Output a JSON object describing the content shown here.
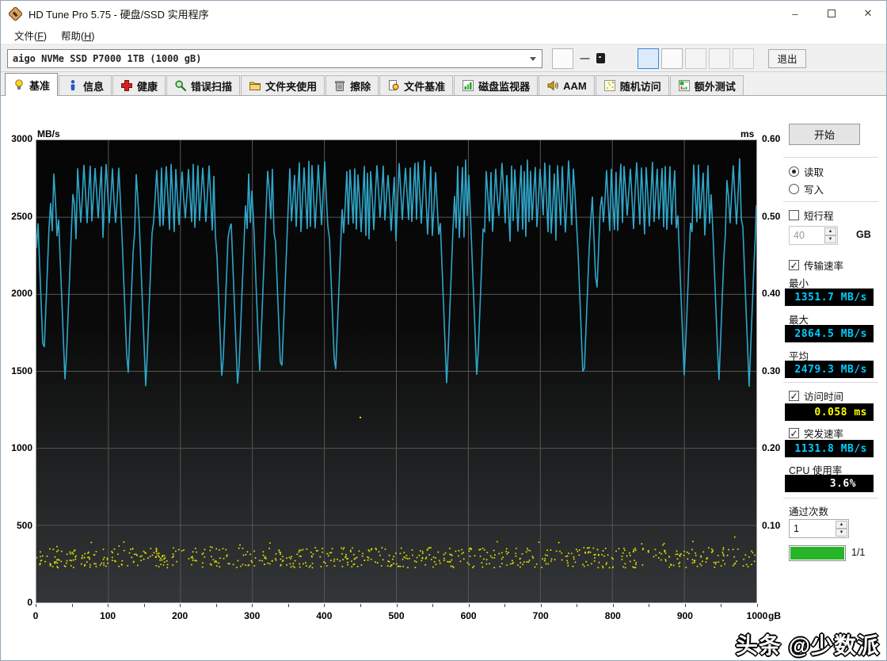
{
  "window": {
    "title": "HD Tune Pro 5.75 - 硬盘/SSD 实用程序",
    "minimize": "–",
    "close": "✕"
  },
  "menu": {
    "file_label": "文件",
    "file_key": "F",
    "help_label": "帮助",
    "help_key": "H"
  },
  "toolbar": {
    "drive_select": "aigo NVMe SSD P7000 1TB (1000 gB)",
    "temperature_dash": "一",
    "exit": "退出",
    "icons": [
      "thermometer-icon",
      "copy-pages-icon",
      "copy-image-icon",
      "camera-icon",
      "percent-icon",
      "download-icon"
    ]
  },
  "tabs": [
    {
      "label": "基准",
      "icon": "bulb-icon",
      "active": true
    },
    {
      "label": "信息",
      "icon": "info-icon",
      "active": false
    },
    {
      "label": "健康",
      "icon": "health-cross-icon",
      "active": false
    },
    {
      "label": "错误扫描",
      "icon": "magnifier-icon",
      "active": false
    },
    {
      "label": "文件夹使用",
      "icon": "folder-icon",
      "active": false
    },
    {
      "label": "擦除",
      "icon": "trash-icon",
      "active": false
    },
    {
      "label": "文件基准",
      "icon": "file-benchmark-icon",
      "active": false
    },
    {
      "label": "磁盘监视器",
      "icon": "disk-monitor-icon",
      "active": false
    },
    {
      "label": "AAM",
      "icon": "speaker-icon",
      "active": false
    },
    {
      "label": "随机访问",
      "icon": "random-access-icon",
      "active": false
    },
    {
      "label": "额外测试",
      "icon": "extra-tests-icon",
      "active": false
    }
  ],
  "panel": {
    "start": "开始",
    "read": "读取",
    "write": "写入",
    "mode_selected": "read",
    "short_stroke": "短行程",
    "short_stroke_checked": false,
    "short_stroke_value": "40",
    "short_stroke_unit": "GB",
    "transfer_rate": "传输速率",
    "transfer_rate_checked": true,
    "min_label": "最小",
    "min_value": "1351.7 MB/s",
    "max_label": "最大",
    "max_value": "2864.5 MB/s",
    "avg_label": "平均",
    "avg_value": "2479.3 MB/s",
    "access_time": "访问时间",
    "access_time_checked": true,
    "access_time_value": "0.058 ms",
    "burst_rate": "突发速率",
    "burst_rate_checked": true,
    "burst_rate_value": "1131.8 MB/s",
    "cpu_usage": "CPU 使用率",
    "cpu_usage_value": "3.6%",
    "pass_count": "通过次数",
    "pass_count_value": "1",
    "progress_label": "1/1"
  },
  "watermark": "头条 @少数派",
  "chart_data": {
    "type": "line",
    "title": "HD Tune Pro read benchmark: transfer rate line with access-time scatter",
    "x_axis": {
      "unit": "gB",
      "min": 0,
      "max": 1000,
      "tick_labels": [
        "0",
        "100",
        "200",
        "300",
        "400",
        "500",
        "600",
        "700",
        "800",
        "900",
        "1000"
      ],
      "minor_tick_step": 50
    },
    "y_left": {
      "label": "MB/s",
      "min": 0,
      "max": 3000,
      "tick_labels": [
        "3000",
        "2500",
        "2000",
        "1500",
        "1000",
        "500",
        "0"
      ]
    },
    "y_right": {
      "label": "ms",
      "min": 0,
      "max": 0.6,
      "tick_labels": [
        "0.60",
        "0.50",
        "0.40",
        "0.30",
        "0.20",
        "0.10"
      ]
    },
    "grid": true,
    "colors": {
      "background_top": "#050505",
      "background_bottom": "#333638",
      "grid": "#565656",
      "line": "#2fa6c9",
      "scatter": "#d9d900"
    },
    "series": [
      {
        "name": "transfer_rate_mbps",
        "color": "#2fa6c9",
        "summary": {
          "min": 1351.7,
          "max": 2864.5,
          "avg": 2479.3
        },
        "start_point": [
          0,
          2300
        ],
        "oscillation": {
          "peak_range": [
            2780,
            2870
          ],
          "trough_range": [
            2350,
            2500
          ],
          "step_gb": 2.2
        },
        "deep_dips": [
          [
            10,
            1540
          ],
          [
            40,
            1400
          ],
          [
            127,
            1420
          ],
          [
            152,
            1380
          ],
          [
            258,
            1400
          ],
          [
            280,
            1350
          ],
          [
            310,
            1480
          ],
          [
            340,
            1420
          ],
          [
            415,
            1420
          ],
          [
            570,
            1400
          ],
          [
            612,
            1430
          ],
          [
            760,
            1380
          ],
          [
            778,
            1950
          ],
          [
            900,
            1450
          ],
          [
            948,
            1420
          ],
          [
            990,
            1400
          ]
        ],
        "seed": 7
      },
      {
        "name": "access_time_ms",
        "color": "#d9d900",
        "summary": {
          "value_ms": 0.058
        },
        "band": {
          "center": 0.058,
          "spread": 0.013,
          "count": 700
        },
        "outliers": [
          [
            450,
            0.24
          ]
        ],
        "seed": 13
      }
    ]
  }
}
